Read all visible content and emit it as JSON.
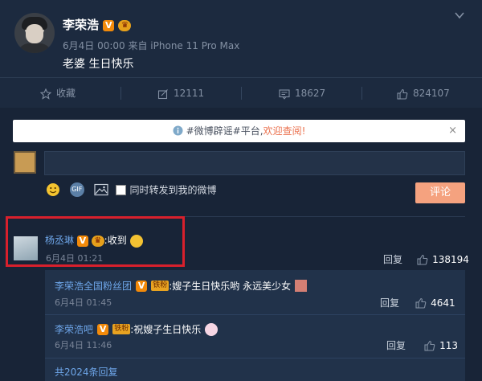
{
  "post": {
    "author": "李荣浩",
    "meta": "6月4日 00:00 来自 iPhone 11 Pro Max",
    "text": "老婆 生日快乐"
  },
  "actions": {
    "favorite": "收藏",
    "repost": "12111",
    "comment": "18627",
    "like": "824107"
  },
  "notice": {
    "prefix": "#微博辟谣#平台,",
    "link": "欢迎查阅!",
    "close": "×"
  },
  "composer": {
    "gif": "GIF",
    "repost_checkbox": "同时转发到我的微博",
    "submit": "评论"
  },
  "comment": {
    "user": "杨丞琳",
    "text": ":收到",
    "time": "6月4日 01:21",
    "reply": "回复",
    "likes": "138194"
  },
  "replies": [
    {
      "user": "李荣浩全国粉丝团",
      "tag": "铁粉",
      "text": ":嫂子生日快乐哟 永远美少女",
      "time": "6月4日 01:45",
      "reply": "回复",
      "likes": "4641"
    },
    {
      "user": "李荣浩吧",
      "tag": "铁粉",
      "text": ":祝嫂子生日快乐",
      "time": "6月4日 11:46",
      "reply": "回复",
      "likes": "113"
    }
  ],
  "more_replies": "共2024条回复",
  "badges": {
    "v": "V",
    "crown": "♛"
  },
  "colors": {
    "accent": "#eb7350",
    "link": "#6ea6e9",
    "highlight": "#d8202c"
  }
}
